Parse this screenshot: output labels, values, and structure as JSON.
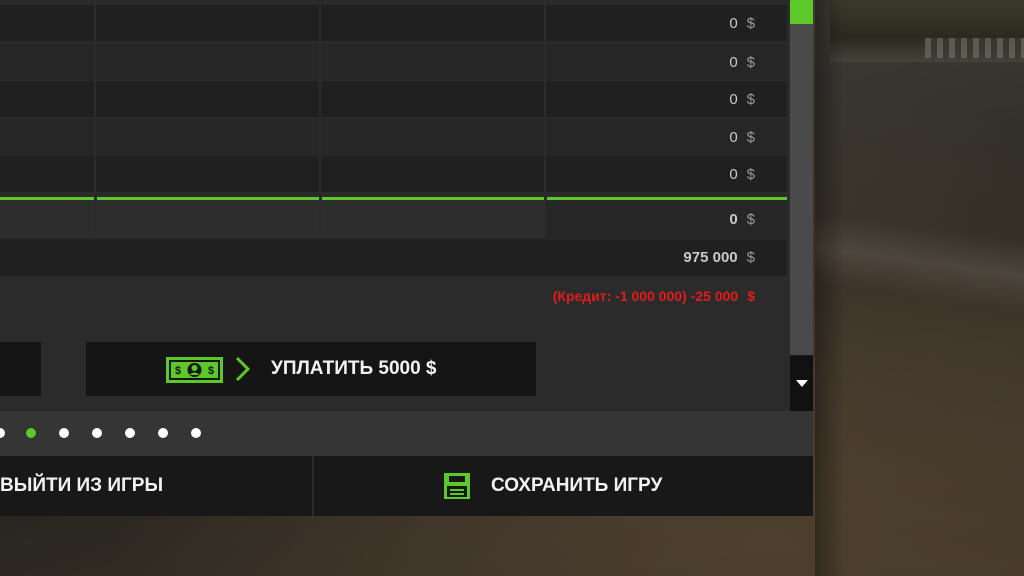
{
  "finance_table": {
    "rows": [
      {
        "amount": "0",
        "currency": "$"
      },
      {
        "amount": "0",
        "currency": "$"
      },
      {
        "amount": "0",
        "currency": "$"
      },
      {
        "amount": "0",
        "currency": "$"
      },
      {
        "amount": "0",
        "currency": "$"
      }
    ],
    "total": {
      "amount": "0",
      "currency": "$"
    },
    "balance": {
      "amount": "975 000",
      "currency": "$"
    },
    "credit": {
      "text": "(Кредит: -1 000 000) -25 000",
      "currency": "$"
    }
  },
  "pay_button": {
    "label": "УПЛАТИТЬ 5000 $",
    "icon": "money-bill-icon"
  },
  "pagination": {
    "active_index": 1,
    "count": 7
  },
  "bottom_bar": {
    "quit_label": "ВЫЙТИ ИЗ ИГРЫ",
    "save_label": "СОХРАНИТЬ ИГРУ",
    "save_icon": "floppy-disk-icon"
  },
  "colors": {
    "accent": "#5cc82a",
    "negative": "#e21b1b"
  }
}
